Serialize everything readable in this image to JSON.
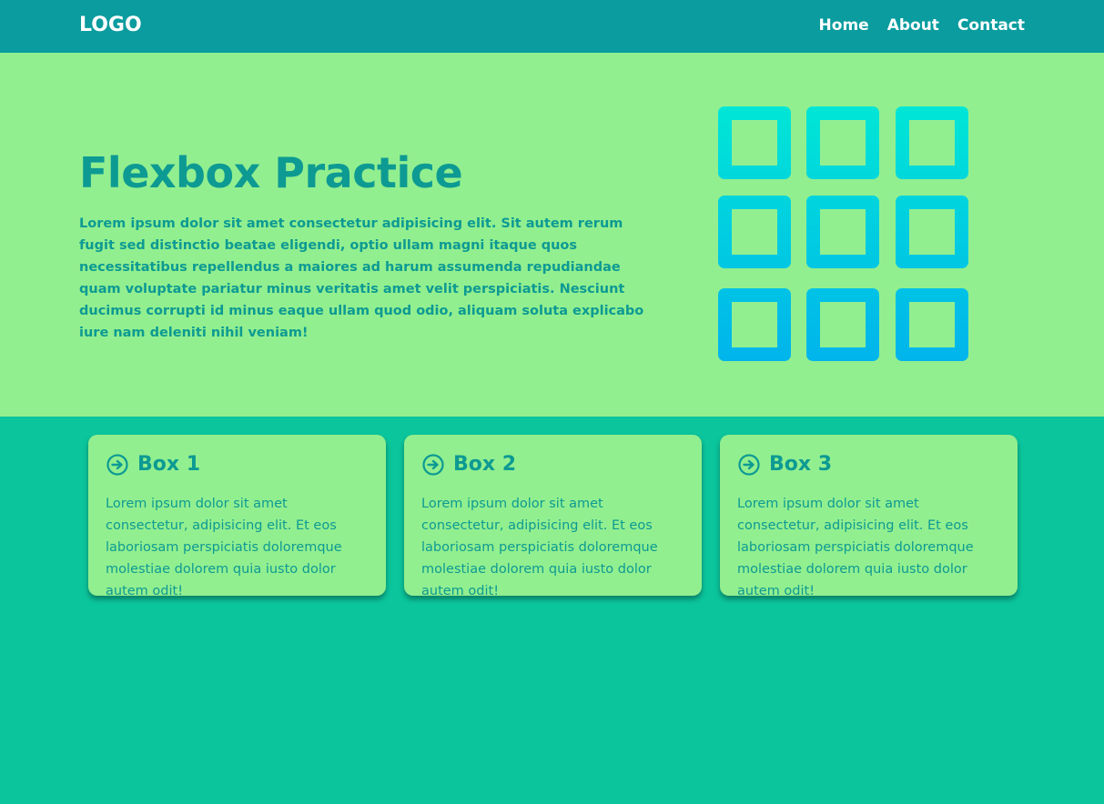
{
  "navbar": {
    "logo": "LOGO",
    "links": [
      "Home",
      "About",
      "Contact"
    ]
  },
  "hero": {
    "title": "Flexbox Practice",
    "text": "Lorem ipsum dolor sit amet consectetur adipisicing elit. Sit autem rerum fugit sed distinctio beatae eligendi, optio ullam magni itaque quos necessitatibus repellendus a maiores ad harum assumenda repudiandae quam voluptate pariatur minus veritatis amet velit perspiciatis. Nesciunt ducimus corrupti id minus eaque ullam quod odio, aliquam soluta explicabo iure nam deleniti nihil veniam!",
    "icon": "grid-icon"
  },
  "boxes": [
    {
      "title": "Box 1",
      "icon": "arrow-circle-right-icon",
      "text": "Lorem ipsum dolor sit amet consectetur, adipisicing elit. Et eos laboriosam perspiciatis doloremque molestiae dolorem quia iusto dolor autem odit!"
    },
    {
      "title": "Box 2",
      "icon": "arrow-circle-right-icon",
      "text": "Lorem ipsum dolor sit amet consectetur, adipisicing elit. Et eos laboriosam perspiciatis doloremque molestiae dolorem quia iusto dolor autem odit!"
    },
    {
      "title": "Box 3",
      "icon": "arrow-circle-right-icon",
      "text": "Lorem ipsum dolor sit amet consectetur, adipisicing elit. Et eos laboriosam perspiciatis doloremque molestiae dolorem quia iusto dolor autem odit!"
    }
  ],
  "colors": {
    "navbar_bg": "#0a9c9e",
    "hero_bg": "#92ef8f",
    "page_bg": "#0bc59c",
    "accent_text": "#0d9a93",
    "grid_gradient_top": "#00e6d6",
    "grid_gradient_bottom": "#00b4ec"
  }
}
